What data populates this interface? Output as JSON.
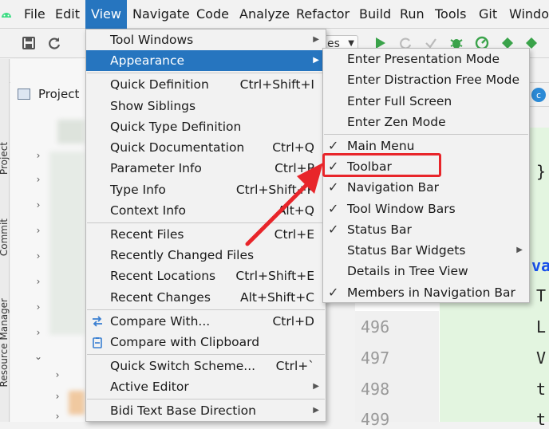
{
  "menubar": {
    "items": [
      "File",
      "Edit",
      "View",
      "Navigate",
      "Code",
      "Analyze",
      "Refactor",
      "Build",
      "Run",
      "Tools",
      "Git",
      "Window"
    ],
    "active": "View"
  },
  "toolbar": {
    "run_config_fragment": "es"
  },
  "tool_windows": {
    "project_tab": "Project",
    "commit_tab": "Commit",
    "resource_manager_tab": "Resource Manager",
    "project_panel_title": "Project"
  },
  "editor": {
    "line_numbers": [
      "496",
      "497",
      "498",
      "499"
    ],
    "code_fragments": [
      "}",
      "va",
      "T",
      "L",
      "V",
      "t",
      "t"
    ]
  },
  "view_menu": {
    "items": [
      {
        "label": "Tool Windows",
        "shortcut": "",
        "submenu": true,
        "highlighted": false
      },
      {
        "label": "Appearance",
        "shortcut": "",
        "submenu": true,
        "highlighted": true
      },
      {
        "label": "Quick Definition",
        "shortcut": "Ctrl+Shift+I"
      },
      {
        "label": "Show Siblings",
        "shortcut": ""
      },
      {
        "label": "Quick Type Definition",
        "shortcut": ""
      },
      {
        "label": "Quick Documentation",
        "shortcut": "Ctrl+Q"
      },
      {
        "label": "Parameter Info",
        "shortcut": "Ctrl+P"
      },
      {
        "label": "Type Info",
        "shortcut": "Ctrl+Shift+P"
      },
      {
        "label": "Context Info",
        "shortcut": "Alt+Q"
      },
      {
        "label": "Recent Files",
        "shortcut": "Ctrl+E"
      },
      {
        "label": "Recently Changed Files",
        "shortcut": ""
      },
      {
        "label": "Recent Locations",
        "shortcut": "Ctrl+Shift+E"
      },
      {
        "label": "Recent Changes",
        "shortcut": "Alt+Shift+C"
      },
      {
        "label": "Compare With...",
        "shortcut": "Ctrl+D"
      },
      {
        "label": "Compare with Clipboard",
        "shortcut": ""
      },
      {
        "label": "Quick Switch Scheme...",
        "shortcut": "Ctrl+`"
      },
      {
        "label": "Active Editor",
        "shortcut": "",
        "submenu": true
      },
      {
        "label": "Bidi Text Base Direction",
        "shortcut": "",
        "submenu": true
      }
    ]
  },
  "appearance_menu": {
    "items": [
      {
        "label": "Enter Presentation Mode",
        "checked": false
      },
      {
        "label": "Enter Distraction Free Mode",
        "checked": false
      },
      {
        "label": "Enter Full Screen",
        "checked": false
      },
      {
        "label": "Enter Zen Mode",
        "checked": false
      },
      {
        "label": "Main Menu",
        "checked": true
      },
      {
        "label": "Toolbar",
        "checked": true
      },
      {
        "label": "Navigation Bar",
        "checked": true
      },
      {
        "label": "Tool Window Bars",
        "checked": true
      },
      {
        "label": "Status Bar",
        "checked": true
      },
      {
        "label": "Status Bar Widgets",
        "checked": false,
        "submenu": true
      },
      {
        "label": "Details in Tree View",
        "checked": false
      },
      {
        "label": "Members in Navigation Bar",
        "checked": true
      }
    ]
  },
  "colors": {
    "highlight": "#2675bf",
    "annotation_red": "#e8252a",
    "run_green": "#3aa34a"
  },
  "icons": {
    "check": "✓",
    "submenu_arrow": "▶",
    "chevron": "›"
  }
}
